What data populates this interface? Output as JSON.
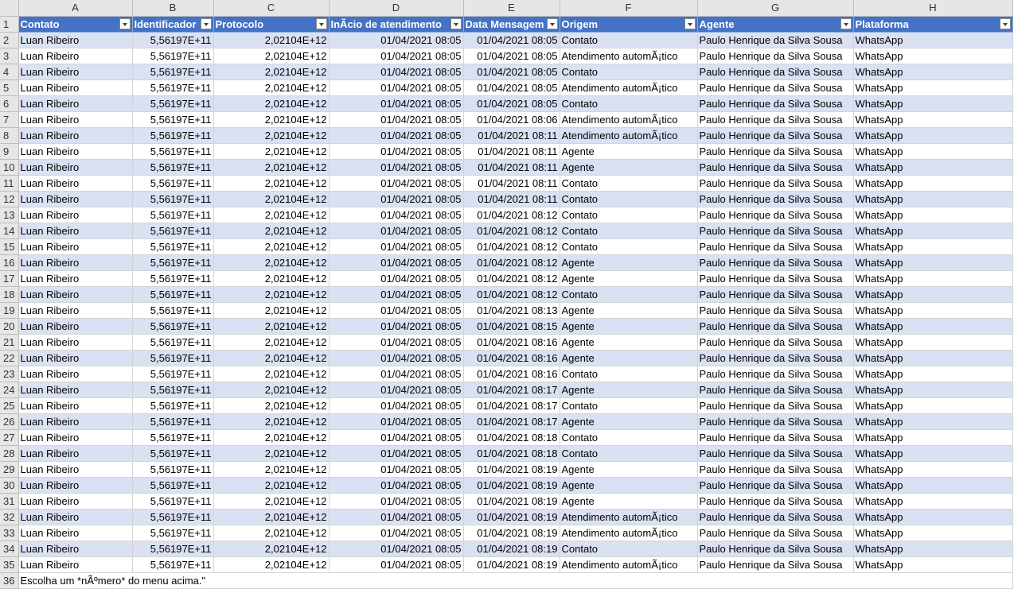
{
  "column_letters": [
    "A",
    "B",
    "C",
    "D",
    "E",
    "F",
    "G",
    "H"
  ],
  "headers": [
    "Contato",
    "Identificador",
    "Protocolo",
    "InÃ­cio de atendimento",
    "Data Mensagem",
    "Origem",
    "Agente",
    "Plataforma"
  ],
  "rows": [
    {
      "n": "2",
      "c": [
        "Luan Ribeiro",
        "5,56197E+11",
        "2,02104E+12",
        "01/04/2021 08:05",
        "01/04/2021 08:05",
        "Contato",
        "Paulo Henrique da Silva Sousa",
        "WhatsApp"
      ]
    },
    {
      "n": "3",
      "c": [
        "Luan Ribeiro",
        "5,56197E+11",
        "2,02104E+12",
        "01/04/2021 08:05",
        "01/04/2021 08:05",
        "Atendimento automÃ¡tico",
        "Paulo Henrique da Silva Sousa",
        "WhatsApp"
      ]
    },
    {
      "n": "4",
      "c": [
        "Luan Ribeiro",
        "5,56197E+11",
        "2,02104E+12",
        "01/04/2021 08:05",
        "01/04/2021 08:05",
        "Contato",
        "Paulo Henrique da Silva Sousa",
        "WhatsApp"
      ]
    },
    {
      "n": "5",
      "c": [
        "Luan Ribeiro",
        "5,56197E+11",
        "2,02104E+12",
        "01/04/2021 08:05",
        "01/04/2021 08:05",
        "Atendimento automÃ¡tico",
        "Paulo Henrique da Silva Sousa",
        "WhatsApp"
      ]
    },
    {
      "n": "6",
      "c": [
        "Luan Ribeiro",
        "5,56197E+11",
        "2,02104E+12",
        "01/04/2021 08:05",
        "01/04/2021 08:05",
        "Contato",
        "Paulo Henrique da Silva Sousa",
        "WhatsApp"
      ]
    },
    {
      "n": "7",
      "c": [
        "Luan Ribeiro",
        "5,56197E+11",
        "2,02104E+12",
        "01/04/2021 08:05",
        "01/04/2021 08:06",
        "Atendimento automÃ¡tico",
        "Paulo Henrique da Silva Sousa",
        "WhatsApp"
      ]
    },
    {
      "n": "8",
      "c": [
        "Luan Ribeiro",
        "5,56197E+11",
        "2,02104E+12",
        "01/04/2021 08:05",
        "01/04/2021 08:11",
        "Atendimento automÃ¡tico",
        "Paulo Henrique da Silva Sousa",
        "WhatsApp"
      ]
    },
    {
      "n": "9",
      "c": [
        "Luan Ribeiro",
        "5,56197E+11",
        "2,02104E+12",
        "01/04/2021 08:05",
        "01/04/2021 08:11",
        "Agente",
        "Paulo Henrique da Silva Sousa",
        "WhatsApp"
      ]
    },
    {
      "n": "10",
      "c": [
        "Luan Ribeiro",
        "5,56197E+11",
        "2,02104E+12",
        "01/04/2021 08:05",
        "01/04/2021 08:11",
        "Agente",
        "Paulo Henrique da Silva Sousa",
        "WhatsApp"
      ]
    },
    {
      "n": "11",
      "c": [
        "Luan Ribeiro",
        "5,56197E+11",
        "2,02104E+12",
        "01/04/2021 08:05",
        "01/04/2021 08:11",
        "Contato",
        "Paulo Henrique da Silva Sousa",
        "WhatsApp"
      ]
    },
    {
      "n": "12",
      "c": [
        "Luan Ribeiro",
        "5,56197E+11",
        "2,02104E+12",
        "01/04/2021 08:05",
        "01/04/2021 08:11",
        "Contato",
        "Paulo Henrique da Silva Sousa",
        "WhatsApp"
      ]
    },
    {
      "n": "13",
      "c": [
        "Luan Ribeiro",
        "5,56197E+11",
        "2,02104E+12",
        "01/04/2021 08:05",
        "01/04/2021 08:12",
        "Contato",
        "Paulo Henrique da Silva Sousa",
        "WhatsApp"
      ]
    },
    {
      "n": "14",
      "c": [
        "Luan Ribeiro",
        "5,56197E+11",
        "2,02104E+12",
        "01/04/2021 08:05",
        "01/04/2021 08:12",
        "Contato",
        "Paulo Henrique da Silva Sousa",
        "WhatsApp"
      ]
    },
    {
      "n": "15",
      "c": [
        "Luan Ribeiro",
        "5,56197E+11",
        "2,02104E+12",
        "01/04/2021 08:05",
        "01/04/2021 08:12",
        "Contato",
        "Paulo Henrique da Silva Sousa",
        "WhatsApp"
      ]
    },
    {
      "n": "16",
      "c": [
        "Luan Ribeiro",
        "5,56197E+11",
        "2,02104E+12",
        "01/04/2021 08:05",
        "01/04/2021 08:12",
        "Agente",
        "Paulo Henrique da Silva Sousa",
        "WhatsApp"
      ]
    },
    {
      "n": "17",
      "c": [
        "Luan Ribeiro",
        "5,56197E+11",
        "2,02104E+12",
        "01/04/2021 08:05",
        "01/04/2021 08:12",
        "Agente",
        "Paulo Henrique da Silva Sousa",
        "WhatsApp"
      ]
    },
    {
      "n": "18",
      "c": [
        "Luan Ribeiro",
        "5,56197E+11",
        "2,02104E+12",
        "01/04/2021 08:05",
        "01/04/2021 08:12",
        "Contato",
        "Paulo Henrique da Silva Sousa",
        "WhatsApp"
      ]
    },
    {
      "n": "19",
      "c": [
        "Luan Ribeiro",
        "5,56197E+11",
        "2,02104E+12",
        "01/04/2021 08:05",
        "01/04/2021 08:13",
        "Agente",
        "Paulo Henrique da Silva Sousa",
        "WhatsApp"
      ]
    },
    {
      "n": "20",
      "c": [
        "Luan Ribeiro",
        "5,56197E+11",
        "2,02104E+12",
        "01/04/2021 08:05",
        "01/04/2021 08:15",
        "Agente",
        "Paulo Henrique da Silva Sousa",
        "WhatsApp"
      ]
    },
    {
      "n": "21",
      "c": [
        "Luan Ribeiro",
        "5,56197E+11",
        "2,02104E+12",
        "01/04/2021 08:05",
        "01/04/2021 08:16",
        "Agente",
        "Paulo Henrique da Silva Sousa",
        "WhatsApp"
      ]
    },
    {
      "n": "22",
      "c": [
        "Luan Ribeiro",
        "5,56197E+11",
        "2,02104E+12",
        "01/04/2021 08:05",
        "01/04/2021 08:16",
        "Agente",
        "Paulo Henrique da Silva Sousa",
        "WhatsApp"
      ]
    },
    {
      "n": "23",
      "c": [
        "Luan Ribeiro",
        "5,56197E+11",
        "2,02104E+12",
        "01/04/2021 08:05",
        "01/04/2021 08:16",
        "Contato",
        "Paulo Henrique da Silva Sousa",
        "WhatsApp"
      ]
    },
    {
      "n": "24",
      "c": [
        "Luan Ribeiro",
        "5,56197E+11",
        "2,02104E+12",
        "01/04/2021 08:05",
        "01/04/2021 08:17",
        "Agente",
        "Paulo Henrique da Silva Sousa",
        "WhatsApp"
      ]
    },
    {
      "n": "25",
      "c": [
        "Luan Ribeiro",
        "5,56197E+11",
        "2,02104E+12",
        "01/04/2021 08:05",
        "01/04/2021 08:17",
        "Contato",
        "Paulo Henrique da Silva Sousa",
        "WhatsApp"
      ]
    },
    {
      "n": "26",
      "c": [
        "Luan Ribeiro",
        "5,56197E+11",
        "2,02104E+12",
        "01/04/2021 08:05",
        "01/04/2021 08:17",
        "Agente",
        "Paulo Henrique da Silva Sousa",
        "WhatsApp"
      ]
    },
    {
      "n": "27",
      "c": [
        "Luan Ribeiro",
        "5,56197E+11",
        "2,02104E+12",
        "01/04/2021 08:05",
        "01/04/2021 08:18",
        "Contato",
        "Paulo Henrique da Silva Sousa",
        "WhatsApp"
      ]
    },
    {
      "n": "28",
      "c": [
        "Luan Ribeiro",
        "5,56197E+11",
        "2,02104E+12",
        "01/04/2021 08:05",
        "01/04/2021 08:18",
        "Contato",
        "Paulo Henrique da Silva Sousa",
        "WhatsApp"
      ]
    },
    {
      "n": "29",
      "c": [
        "Luan Ribeiro",
        "5,56197E+11",
        "2,02104E+12",
        "01/04/2021 08:05",
        "01/04/2021 08:19",
        "Agente",
        "Paulo Henrique da Silva Sousa",
        "WhatsApp"
      ]
    },
    {
      "n": "30",
      "c": [
        "Luan Ribeiro",
        "5,56197E+11",
        "2,02104E+12",
        "01/04/2021 08:05",
        "01/04/2021 08:19",
        "Agente",
        "Paulo Henrique da Silva Sousa",
        "WhatsApp"
      ]
    },
    {
      "n": "31",
      "c": [
        "Luan Ribeiro",
        "5,56197E+11",
        "2,02104E+12",
        "01/04/2021 08:05",
        "01/04/2021 08:19",
        "Agente",
        "Paulo Henrique da Silva Sousa",
        "WhatsApp"
      ]
    },
    {
      "n": "32",
      "c": [
        "Luan Ribeiro",
        "5,56197E+11",
        "2,02104E+12",
        "01/04/2021 08:05",
        "01/04/2021 08:19",
        "Atendimento automÃ¡tico",
        "Paulo Henrique da Silva Sousa",
        "WhatsApp"
      ]
    },
    {
      "n": "33",
      "c": [
        "Luan Ribeiro",
        "5,56197E+11",
        "2,02104E+12",
        "01/04/2021 08:05",
        "01/04/2021 08:19",
        "Atendimento automÃ¡tico",
        "Paulo Henrique da Silva Sousa",
        "WhatsApp"
      ]
    },
    {
      "n": "34",
      "c": [
        "Luan Ribeiro",
        "5,56197E+11",
        "2,02104E+12",
        "01/04/2021 08:05",
        "01/04/2021 08:19",
        "Contato",
        "Paulo Henrique da Silva Sousa",
        "WhatsApp"
      ]
    },
    {
      "n": "35",
      "c": [
        "Luan Ribeiro",
        "5,56197E+11",
        "2,02104E+12",
        "01/04/2021 08:05",
        "01/04/2021 08:19",
        "Atendimento automÃ¡tico",
        "Paulo Henrique da Silva Sousa",
        "WhatsApp"
      ]
    }
  ],
  "trailing_row": {
    "n": "36",
    "text": "Escolha um *nÃºmero* do menu acima.\""
  },
  "colors": {
    "header_fill": "#4472c4",
    "band_fill": "#d9e1f2",
    "grid": "#d4d4d4"
  }
}
